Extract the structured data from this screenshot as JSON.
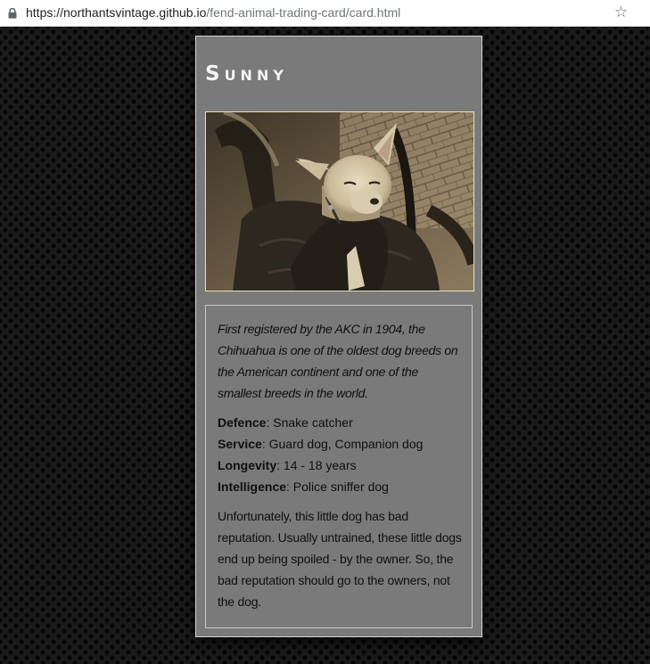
{
  "browser": {
    "url_host": "https://northantsvintage.github.io",
    "url_path": "/fend-animal-trading-card/card.html"
  },
  "card": {
    "title": "Sunny",
    "description": "First registered by the AKC in 1904, the Chihuahua is one of the oldest dog breeds on the American continent and one of the smallest breeds in the world.",
    "stats": [
      {
        "label": "Defence",
        "value": ": Snake catcher"
      },
      {
        "label": "Service",
        "value": ": Guard dog, Companion dog"
      },
      {
        "label": "Longevity",
        "value": ": 14 - 18 years"
      },
      {
        "label": "Intelligence",
        "value": ": Police sniffer dog"
      }
    ],
    "note": "Unfortunately, this little dog has bad reputation. Usually untrained, these little dogs end up being spoiled - by the owner. So, the bad reputation should go to the owners, not the dog."
  },
  "colors": {
    "card_background": "#7a7a7a",
    "page_background": "#1b1b1b",
    "photo_border": "#e9e2b4"
  }
}
